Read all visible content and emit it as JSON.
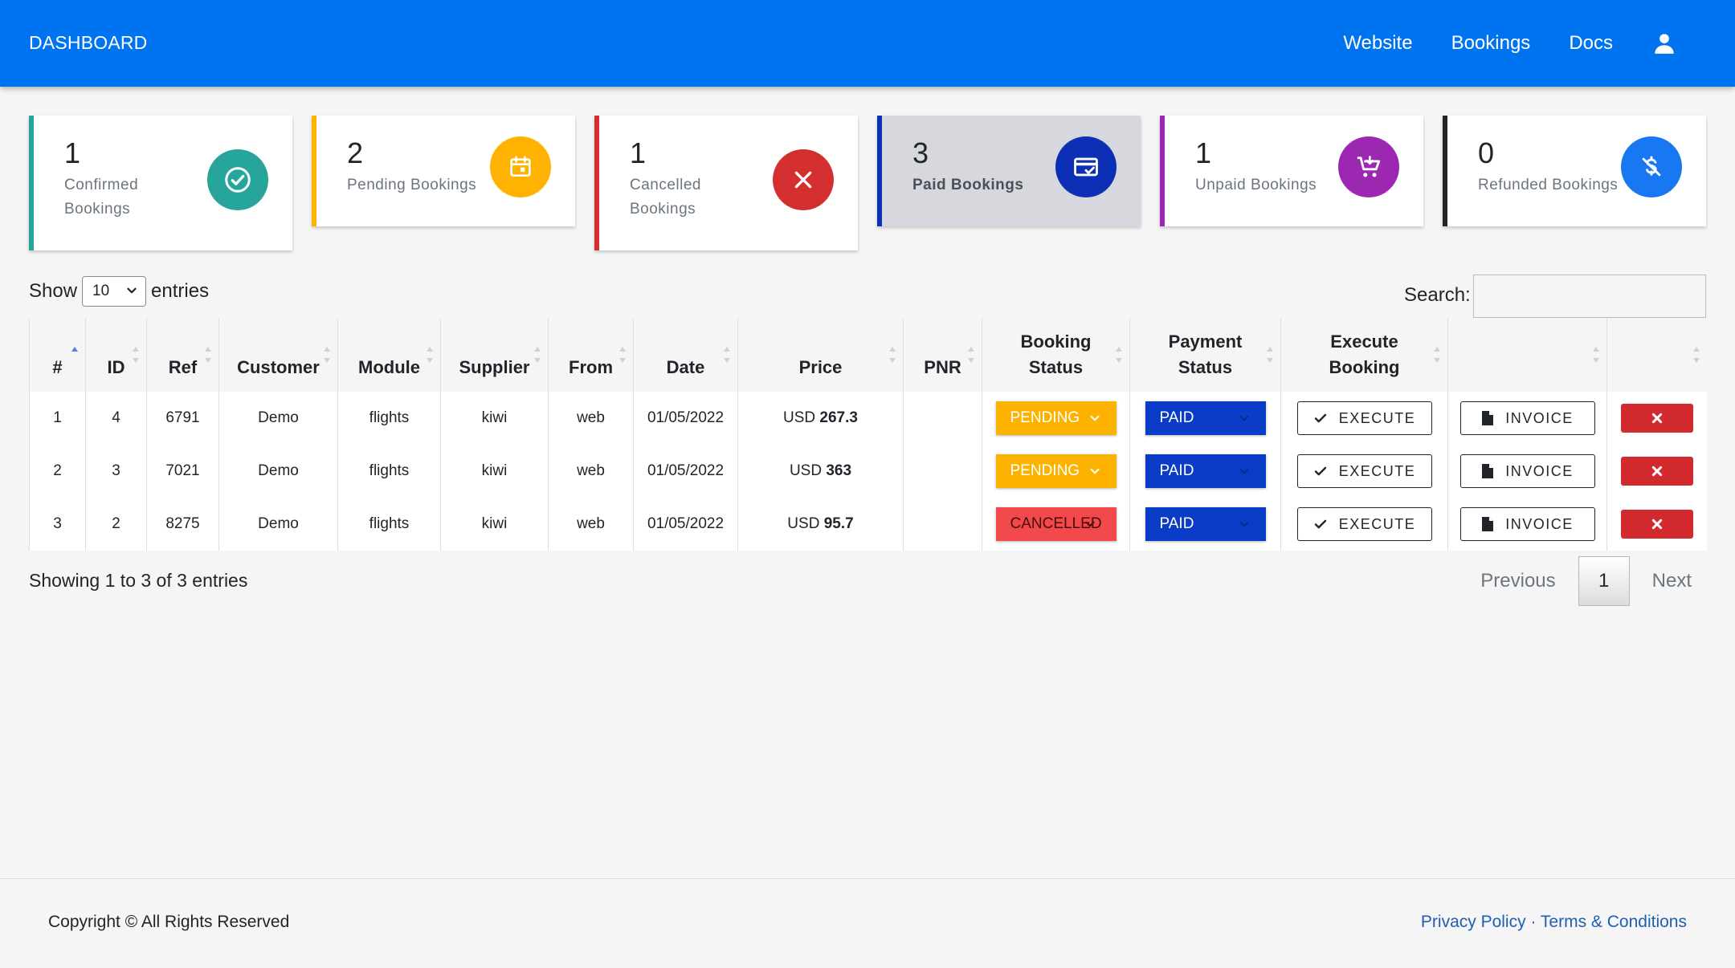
{
  "header": {
    "brand": "DASHBOARD",
    "nav": [
      "Website",
      "Bookings",
      "Docs"
    ],
    "user_icon": "user-icon",
    "color": "#0074f0"
  },
  "cards": [
    {
      "count": "1",
      "label": "Confirmed Bookings",
      "color": "#26a69a",
      "icon": "check-circle-icon"
    },
    {
      "count": "2",
      "label": "Pending Bookings",
      "color": "#ffb300",
      "icon": "calendar-icon"
    },
    {
      "count": "1",
      "label": "Cancelled Bookings",
      "color": "#d32f2f",
      "icon": "close-icon"
    },
    {
      "count": "3",
      "label": "Paid Bookings",
      "color": "#0d2fb5",
      "icon": "payment-card-icon"
    },
    {
      "count": "1",
      "label": "Unpaid Bookings",
      "color": "#9c27b0",
      "icon": "cart-icon"
    },
    {
      "count": "0",
      "label": "Refunded Bookings",
      "color": "#1877f2",
      "icon": "no-dollar-icon"
    }
  ],
  "controls": {
    "show_label": "Show",
    "entries_value": "10",
    "entries_label": "entries",
    "search_label": "Search:",
    "search_value": ""
  },
  "table": {
    "columns": [
      "#",
      "ID",
      "Ref",
      "Customer",
      "Module",
      "Supplier",
      "From",
      "Date",
      "Price",
      "PNR",
      "Booking Status",
      "Payment Status",
      "Execute Booking",
      "",
      ""
    ],
    "rows": [
      {
        "num": "1",
        "id": "4",
        "ref": "6791",
        "customer": "Demo",
        "module": "flights",
        "supplier": "kiwi",
        "from": "web",
        "date": "01/05/2022",
        "currency": "USD",
        "price": "267.3",
        "pnr": "",
        "booking_status": "PENDING",
        "payment_status": "PAID",
        "execute": "EXECUTE",
        "invoice": "INVOICE"
      },
      {
        "num": "2",
        "id": "3",
        "ref": "7021",
        "customer": "Demo",
        "module": "flights",
        "supplier": "kiwi",
        "from": "web",
        "date": "01/05/2022",
        "currency": "USD",
        "price": "363",
        "pnr": "",
        "booking_status": "PENDING",
        "payment_status": "PAID",
        "execute": "EXECUTE",
        "invoice": "INVOICE"
      },
      {
        "num": "3",
        "id": "2",
        "ref": "8275",
        "customer": "Demo",
        "module": "flights",
        "supplier": "kiwi",
        "from": "web",
        "date": "01/05/2022",
        "currency": "USD",
        "price": "95.7",
        "pnr": "",
        "booking_status": "CANCELLED",
        "payment_status": "PAID",
        "execute": "EXECUTE",
        "invoice": "INVOICE"
      }
    ]
  },
  "pagination": {
    "info": "Showing 1 to 3 of 3 entries",
    "previous": "Previous",
    "current_page": "1",
    "next": "Next"
  },
  "footer": {
    "copyright": "Copyright © All Rights Reserved",
    "privacy": "Privacy Policy",
    "separator": "·",
    "terms": "Terms & Conditions"
  }
}
